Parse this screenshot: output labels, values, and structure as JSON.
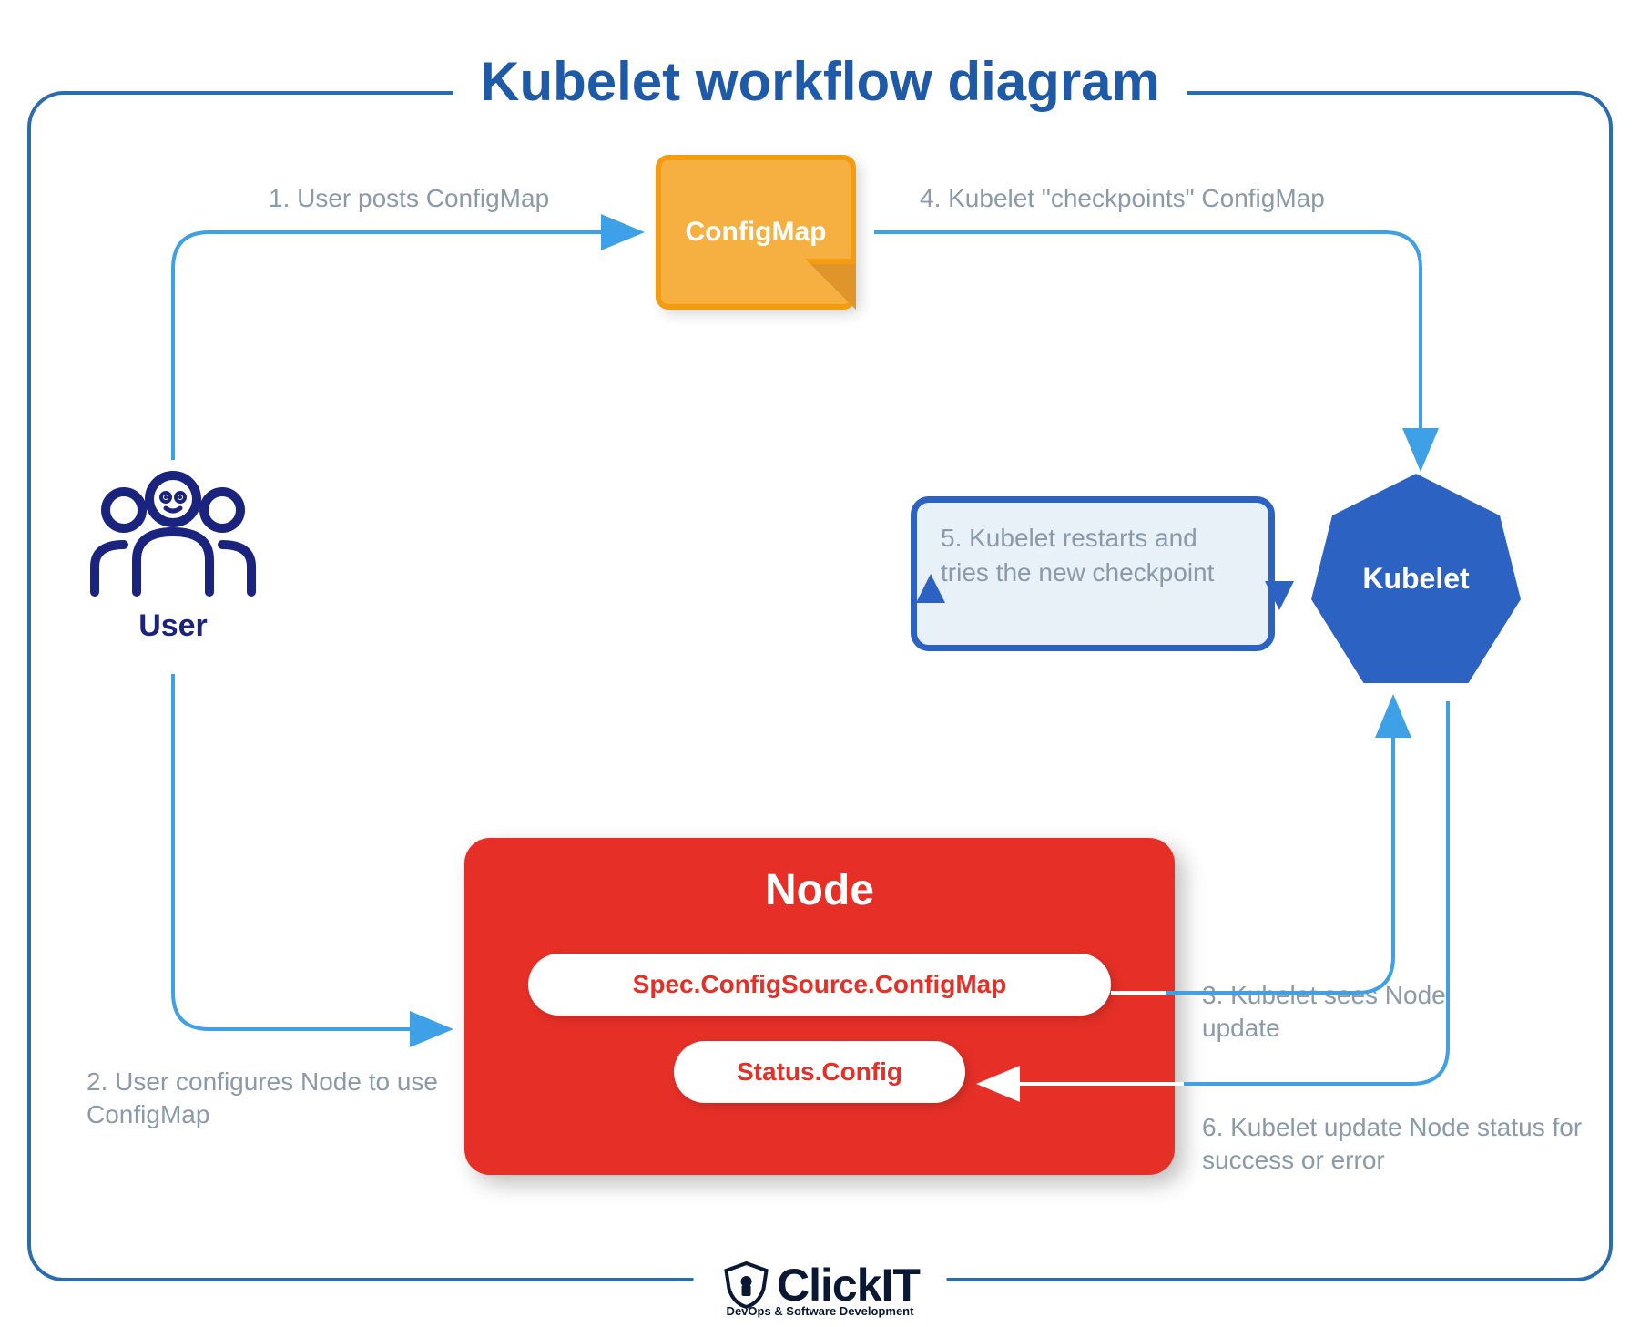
{
  "title": "Kubelet workflow diagram",
  "user": {
    "label": "User"
  },
  "configmap": {
    "label": "ConfigMap"
  },
  "kubelet": {
    "label": "Kubelet"
  },
  "restart_box": {
    "text": "5. Kubelet restarts and tries the new checkpoint"
  },
  "node": {
    "title": "Node",
    "spec_pill": "Spec.ConfigSource.ConfigMap",
    "status_pill": "Status.Config"
  },
  "steps": {
    "s1": "1. User posts ConfigMap",
    "s2": "2. User configures Node to use ConfigMap",
    "s3": "3. Kubelet sees Node update",
    "s4": "4. Kubelet \"checkpoints\" ConfigMap",
    "s6": "6. Kubelet update Node status for success or error"
  },
  "logo": {
    "name": "ClickIT",
    "subtitle": "DevOps & Software Development"
  }
}
